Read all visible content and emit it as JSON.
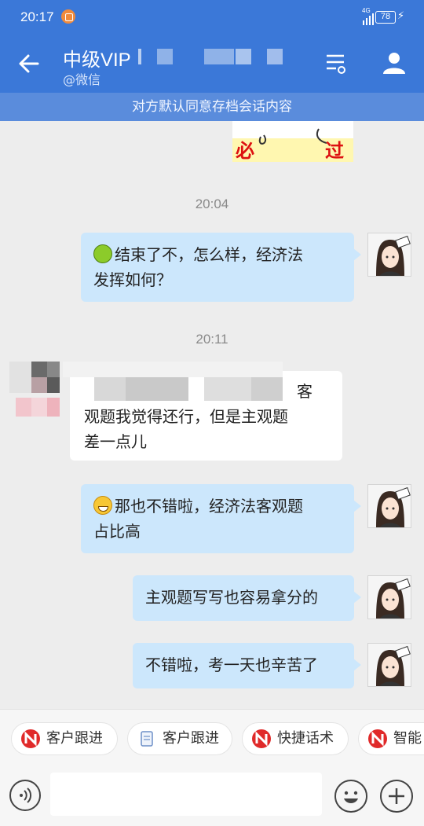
{
  "status_bar": {
    "time": "20:17",
    "network": "4G",
    "battery": "78"
  },
  "header": {
    "title": "中级VIP",
    "subtitle": "@微信"
  },
  "notice": "对方默认同意存档会话内容",
  "chat": {
    "sticker": {
      "left_text": "必",
      "right_text": "过"
    },
    "messages": [
      {
        "type": "time",
        "text": "20:04"
      },
      {
        "type": "me",
        "text": "结束了不，怎么样，经济法发挥如何？",
        "line1": "结束了不，怎么样，经济法",
        "line2": "发挥如何？",
        "emoji": "sprout-emoji"
      },
      {
        "type": "time",
        "text": "20:11"
      },
      {
        "type": "them",
        "line1": "客",
        "line2": "观题我觉得还行，但是主观题",
        "line3": "差一点儿"
      },
      {
        "type": "me",
        "line1": "那也不错啦，经济法客观题",
        "line2": "占比高",
        "emoji": "grin-emoji"
      },
      {
        "type": "me",
        "text": "主观题写写也容易拿分的"
      },
      {
        "type": "me",
        "text": "不错啦，考一天也辛苦了"
      }
    ]
  },
  "quick_replies": [
    "客户跟进",
    "客户跟进",
    "快捷话术",
    "智能"
  ],
  "input": {
    "placeholder": ""
  },
  "colors": {
    "header": "#3b78d8",
    "notice": "#5a8cdc",
    "bubble_me": "#cce7fc",
    "accent_red": "#e02a2a"
  }
}
